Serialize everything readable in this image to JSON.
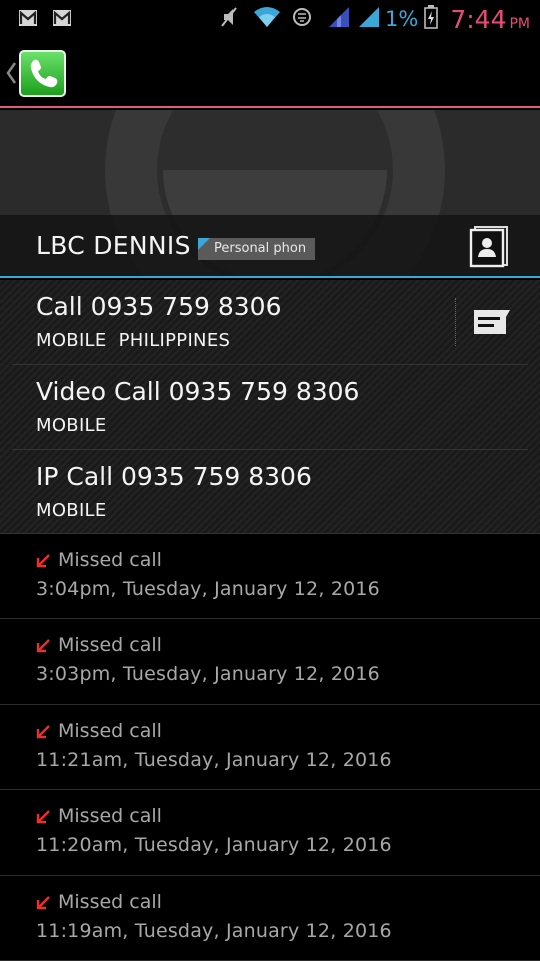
{
  "status_bar": {
    "battery_percent": "1%",
    "time": "7:44",
    "ampm": "PM",
    "clock_color": "#e84b7a",
    "battery_text_color": "#3aa7d8"
  },
  "contact": {
    "name": "LBC DENNIS",
    "account_label": "Personal phon"
  },
  "actions": [
    {
      "title": "Call 0935 759 8306",
      "subtitle": "MOBILE  PHILIPPINES"
    },
    {
      "title": "Video Call 0935 759 8306",
      "subtitle": "MOBILE"
    },
    {
      "title": "IP Call 0935 759 8306",
      "subtitle": "MOBILE"
    }
  ],
  "history": [
    {
      "type": "Missed call",
      "time": "3:04pm, Tuesday, January 12, 2016"
    },
    {
      "type": "Missed call",
      "time": "3:03pm, Tuesday, January 12, 2016"
    },
    {
      "type": "Missed call",
      "time": "11:21am, Tuesday, January 12, 2016"
    },
    {
      "type": "Missed call",
      "time": "11:20am, Tuesday, January 12, 2016"
    },
    {
      "type": "Missed call",
      "time": "11:19am, Tuesday, January 12, 2016"
    }
  ],
  "colors": {
    "accent_blue": "#39a9d6",
    "accent_pink": "#e05a82",
    "missed_red": "#e8302e",
    "phone_green": "#2dbb2d"
  },
  "icons": {
    "status_left": [
      "gmail-icon",
      "gmail-icon"
    ],
    "status_right": [
      "mute-icon",
      "wifi-icon",
      "sync-icon",
      "signal-icon",
      "signal-icon",
      "battery-icon"
    ],
    "app": "phone-icon",
    "contact_card": "contact-card-icon",
    "message": "message-icon",
    "missed": "missed-call-arrow-icon"
  }
}
